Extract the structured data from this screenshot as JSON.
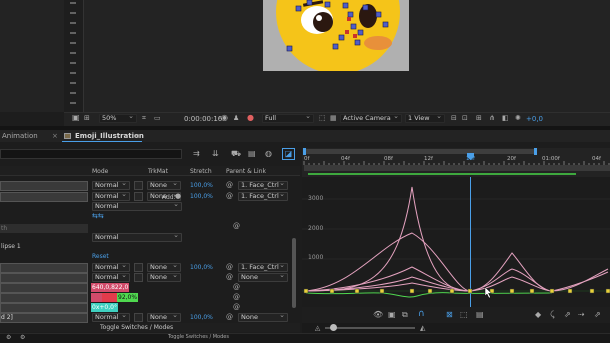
{
  "viewer": {
    "zoom": "50%",
    "timecode": "0:00:00:16",
    "resolution": "Full",
    "camera": "Active Camera",
    "views": "1 View",
    "exposure": "+0,0"
  },
  "tabs": {
    "left": "Animation",
    "active": "Emoji_Illustration"
  },
  "columns": {
    "mode": "Mode",
    "trkmat": "TrkMat",
    "stretch": "Stretch",
    "parent": "Parent & Link"
  },
  "ruler": {
    "ticks": [
      "0f",
      "04f",
      "08f",
      "12f",
      "16f",
      "20f",
      "01:00f",
      "04f"
    ]
  },
  "graph": {
    "y_labels": [
      "3000",
      "2000",
      "1000"
    ]
  },
  "layers": {
    "row1": {
      "mode": "Normal",
      "trkmat": "None",
      "stretch": "100,0%",
      "parent": "1. Face_Ctrl"
    },
    "row2": {
      "mode": "Normal",
      "trkmat": "None",
      "stretch": "100,0%",
      "parent": "1. Face_Ctrl"
    },
    "add_label": "Add:",
    "row3": {
      "mode": "Normal"
    },
    "row4_name": "th",
    "row4": {
      "mode": "Normal"
    },
    "row5_name": "lipse 1",
    "reset": "Reset",
    "row6": {
      "mode": "Normal",
      "trkmat": "None",
      "stretch": "100,0%",
      "parent": "1. Face_Ctrl"
    },
    "row7": {
      "mode": "Normal",
      "trkmat": "None",
      "parent": "None"
    },
    "position": "640,0,822,0",
    "scale_a": "",
    "scale_b": "92,0%",
    "rotation": "0x+0,0°",
    "last_name": "d 2]",
    "last": {
      "mode": "Normal",
      "trkmat": "None",
      "stretch": "100,0%",
      "parent": "None"
    }
  },
  "footer": {
    "toggle": "Toggle Switches / Modes",
    "status_toggle": "Toggle Switches / Modes"
  },
  "colors": {
    "accent": "#4a9fe8",
    "curve": "#e4a2bf",
    "yellow": "#e8d23a",
    "green": "#4fd84f",
    "red": "#e23b4b"
  }
}
